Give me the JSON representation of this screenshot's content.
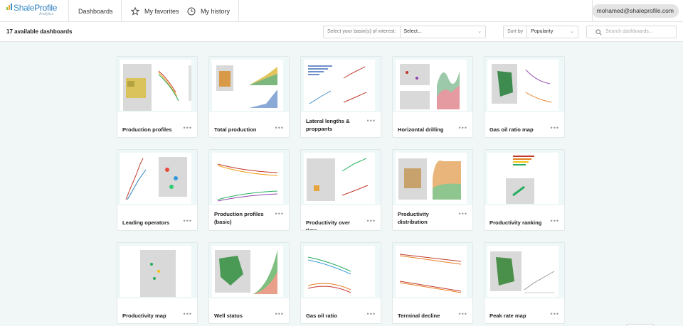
{
  "brand": {
    "name_a": "Shale",
    "name_b": "Profile",
    "sub": "Analytics"
  },
  "nav": {
    "dashboards": "Dashboards",
    "favorites": "My favorites",
    "history": "My history"
  },
  "user": {
    "email": "mohamed@shaleprofile.com"
  },
  "toolbar": {
    "count_label": "17 available dashboards",
    "basin_label": "Select your basin(s) of interest:",
    "basin_value": "Select...",
    "sort_label": "Sort by",
    "sort_value": "Popularity",
    "search_placeholder": "Search dashboards..."
  },
  "cards": [
    {
      "title": "Production profiles"
    },
    {
      "title": "Total production"
    },
    {
      "title": "Lateral lengths & proppants"
    },
    {
      "title": "Horizontal drilling"
    },
    {
      "title": "Gas oil ratio map"
    },
    {
      "title": "Leading operators"
    },
    {
      "title": "Production profiles (basic)"
    },
    {
      "title": "Productivity over time"
    },
    {
      "title": "Productivity distribution"
    },
    {
      "title": "Productivity ranking"
    },
    {
      "title": "Productivity map"
    },
    {
      "title": "Well status"
    },
    {
      "title": "Gas oil ratio"
    },
    {
      "title": "Terminal decline"
    },
    {
      "title": "Peak rate map"
    }
  ],
  "card_menu": "•••",
  "colors": {
    "accent": "#3b8fc9",
    "background": "#f1f6f6",
    "thumb_bg": "#eef8f8"
  }
}
